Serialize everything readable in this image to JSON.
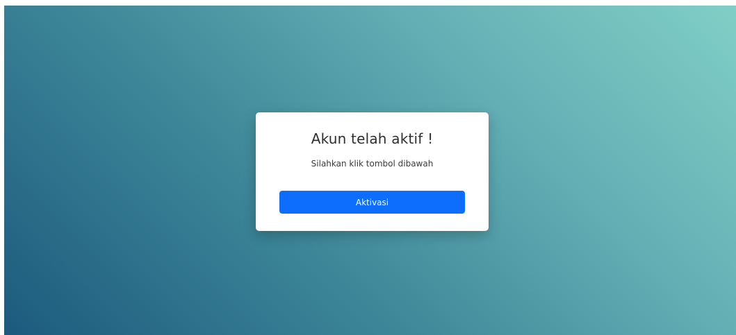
{
  "card": {
    "title": "Akun telah aktif !",
    "subtitle": "Silahkan klik tombol dibawah",
    "button_label": "Aktivasi"
  },
  "colors": {
    "accent": "#0d6efd",
    "gradient_dark": "#1c5a7d",
    "gradient_light": "#80cfc6"
  }
}
